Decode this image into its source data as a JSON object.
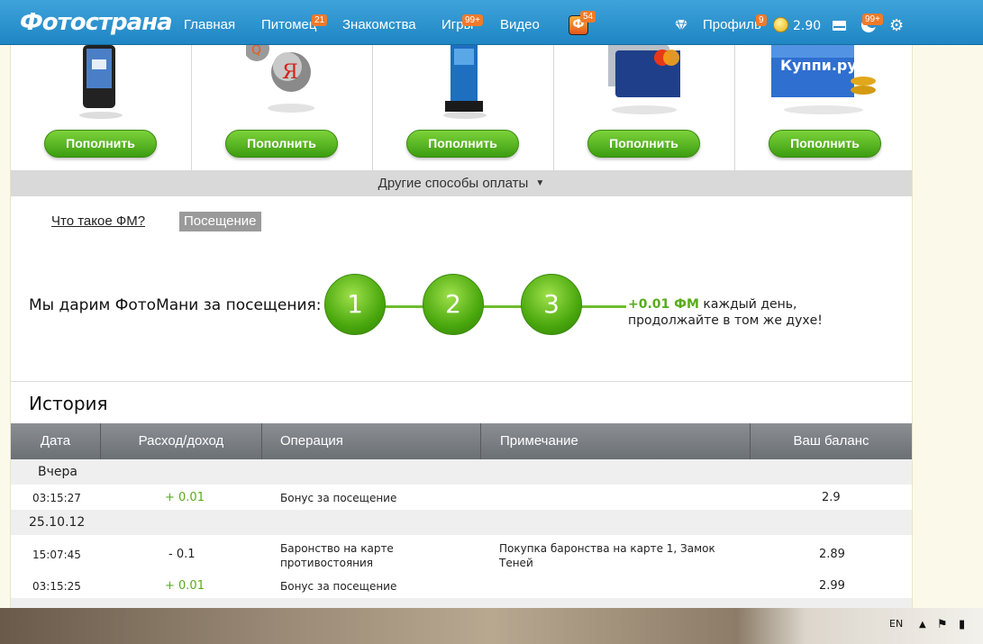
{
  "nav": {
    "logo": "Фотострана",
    "items": [
      {
        "label": "Главная"
      },
      {
        "label": "Питомец",
        "badge": "21"
      },
      {
        "label": "Знакомства"
      },
      {
        "label": "Игры",
        "badge": "99+"
      },
      {
        "label": "Видео"
      }
    ],
    "game_badge": "54",
    "game_icon": "Ф",
    "profile_label": "Профиль",
    "profile_badge": "9",
    "balance": "2.90",
    "notify_badge": "99+"
  },
  "payment": {
    "button_label": "Пополнить",
    "methods": [
      "sms-phone",
      "qiwi-yandex",
      "terminal",
      "bank-card",
      "kuppi-wallet"
    ],
    "kuppi_text": "Куппи.ру",
    "other_ways": "Другие способы оплаты"
  },
  "tabs": {
    "what_is": "Что такое ФМ?",
    "visit": "Посещение"
  },
  "visit": {
    "gift_text": "Мы дарим ФотоМани за посещения:",
    "steps": [
      "1",
      "2",
      "3"
    ],
    "bonus_amount": "+0.01 ФМ",
    "bonus_text": "каждый день,",
    "bonus_text2": "продолжайте в том же духе!"
  },
  "history": {
    "title": "История",
    "columns": [
      "Дата",
      "Расход/доход",
      "Операция",
      "Примечание",
      "Ваш баланс"
    ],
    "groups": [
      {
        "day": "Вчера",
        "rows": [
          {
            "time": "03:15:27",
            "amount": "+ 0.01",
            "operation": "Бонус за посещение",
            "note": "",
            "balance": "2.9"
          }
        ]
      },
      {
        "day": "25.10.12",
        "rows": [
          {
            "time": "15:07:45",
            "amount": "- 0.1",
            "operation": "Баронство на карте противостояния",
            "note": "Покупка баронства на карте 1, Замок Теней",
            "balance": "2.89"
          },
          {
            "time": "03:15:25",
            "amount": "+ 0.01",
            "operation": "Бонус за посещение",
            "note": "",
            "balance": "2.99"
          }
        ]
      }
    ]
  },
  "taskbar": {
    "lang": "EN"
  }
}
